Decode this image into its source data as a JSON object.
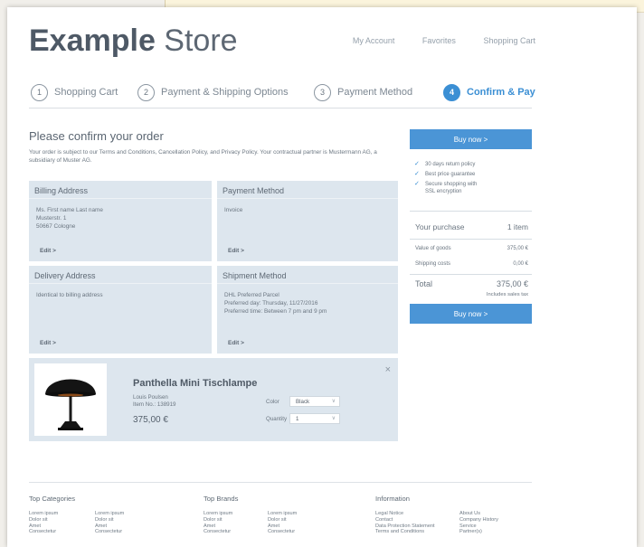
{
  "brand": {
    "bold": "Example",
    "light": " Store"
  },
  "topnav": [
    "My Account",
    "Favorites",
    "Shopping Cart"
  ],
  "steps": [
    {
      "num": "1",
      "label": "Shopping Cart"
    },
    {
      "num": "2",
      "label": "Payment & Shipping Options"
    },
    {
      "num": "3",
      "label": "Payment Method"
    },
    {
      "num": "4",
      "label": "Confirm & Pay"
    }
  ],
  "confirm": {
    "title": "Please confirm your order",
    "terms": "Your order is subject to our Terms and Conditions, Cancellation Policy, and Privacy Policy. Your contractual partner is Mustermann AG, a subsidiary of Muster AG."
  },
  "billing": {
    "title": "Billing Address",
    "lines": [
      "Ms. First name Last name",
      "Musterstr. 1",
      "50667 Cologne"
    ],
    "edit": "Edit >"
  },
  "payment": {
    "title": "Payment Method",
    "lines": [
      "Invoice"
    ],
    "edit": "Edit >"
  },
  "delivery": {
    "title": "Delivery Address",
    "lines": [
      "Identical to billing address"
    ],
    "edit": "Edit >"
  },
  "shipment": {
    "title": "Shipment Method",
    "lines": [
      "DHL Preferred Parcel",
      "Preferred day: Thursday, 11/27/2016",
      "Preferred time: Between 7 pm and 9 pm"
    ],
    "edit": "Edit >"
  },
  "product": {
    "name": "Panthella Mini Tischlampe",
    "brand": "Louis Poulsen",
    "item_no": "Item No.: 138919",
    "price": "375,00 €",
    "color_label": "Color",
    "color_value": "Black",
    "qty_label": "Quantity",
    "qty_value": "1",
    "close": "×"
  },
  "sidebar": {
    "buy_label": "Buy now >",
    "benefits": [
      "30 days return policy",
      "Best price guarantee",
      "Secure shopping with SSL encryption"
    ],
    "purchase_label": "Your purchase",
    "purchase_count": "1 item",
    "goods_label": "Value of goods",
    "goods_value": "375,00 €",
    "shipping_label": "Shipping costs",
    "shipping_value": "0,00 €",
    "total_label": "Total",
    "total_value": "375,00 €",
    "tax_note": "Includes sales tax"
  },
  "footer": {
    "categories_title": "Top Categories",
    "brands_title": "Top Brands",
    "info_title": "Information",
    "lorem": [
      "Lorem ipsum",
      "Dolor sit",
      "Amet",
      "Consectetur"
    ],
    "info_col1": [
      "Legal Notice",
      "Contact",
      "Data Protection Statement",
      "Terms and Conditions"
    ],
    "info_col2": [
      "About Us",
      "Company History",
      "Service",
      "Partner(s)"
    ]
  },
  "colors": {
    "accent": "#3b8fd4",
    "button": "#4b95d6",
    "panel": "#dde6ee"
  }
}
